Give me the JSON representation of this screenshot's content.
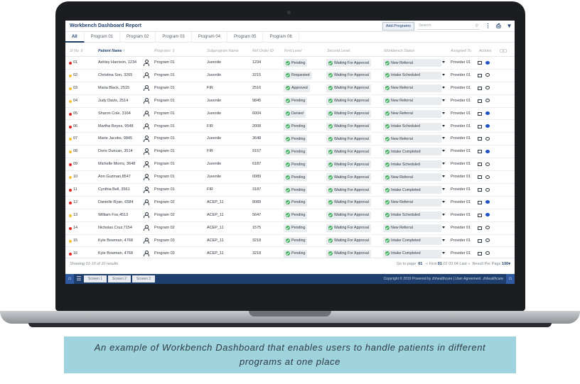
{
  "header": {
    "title": "Workbench Dashboard Report",
    "add_button": "Add Programs",
    "search_placeholder": "Search"
  },
  "tabs": [
    "All",
    "Program 01",
    "Program 02",
    "Program 03",
    "Program 04",
    "Program 05",
    "Program 06"
  ],
  "columns": {
    "sl_no": "Sl No",
    "patient_name": "Patient Name",
    "programs": "Programs",
    "subprogram": "Subprogram Name",
    "ref_order": "Ref Order ID",
    "first_level": "First Level",
    "second_level": "Second Level",
    "workbench_status": "Workbench Status",
    "assigned_to": "Assigned To",
    "actions": "Actions"
  },
  "rows": [
    {
      "sl": "01",
      "priority": "high",
      "name": "Ashley Harrison, 1234",
      "program": "Program 01",
      "sub": "Juvenile",
      "ref": "1234",
      "first": "Pending",
      "second": "Waiting For Approval",
      "status": "New Referral",
      "assigned": "Provider 01",
      "chat": "filled"
    },
    {
      "sl": "02",
      "priority": "medium",
      "name": "Christina Son, 3265",
      "program": "Program 01",
      "sub": "Juvenile",
      "ref": "3215",
      "first": "Requested",
      "second": "Waiting For Approval",
      "status": "Intake Scheduled",
      "assigned": "Provider 01",
      "chat": "outline"
    },
    {
      "sl": "03",
      "priority": "medium",
      "name": "Maria Black, 2515",
      "program": "Program 01",
      "sub": "FIR",
      "ref": "2516",
      "first": "Approved",
      "second": "Waiting For Approval",
      "status": "New Referral",
      "assigned": "Provider 01",
      "chat": "outline"
    },
    {
      "sl": "04",
      "priority": "medium",
      "name": "Judy Davis, 2514",
      "program": "Program 01",
      "sub": "Juvenile",
      "ref": "9845",
      "first": "Pending",
      "second": "Waiting For Approval",
      "status": "New Referral",
      "assigned": "Provider 01",
      "chat": "outline"
    },
    {
      "sl": "05",
      "priority": "high",
      "name": "Sharon Cole, 3164",
      "program": "Program 01",
      "sub": "Juvenile",
      "ref": "6004",
      "first": "Denied",
      "second": "Waiting For Approval",
      "status": "New Referral",
      "assigned": "Provider 01",
      "chat": "filled"
    },
    {
      "sl": "06",
      "priority": "high",
      "name": "Martha Reyes, 9548",
      "program": "Program 01",
      "sub": "FIR",
      "ref": "2008",
      "first": "Pending",
      "second": "Waiting For Approval",
      "status": "Intake Scheduled",
      "assigned": "Provider 01",
      "chat": "filled"
    },
    {
      "sl": "07",
      "priority": "medium",
      "name": "Marie Jacobs, 9845",
      "program": "Program 01",
      "sub": "Juvenile",
      "ref": "3648",
      "first": "Pending",
      "second": "Waiting For Approval",
      "status": "New Referral",
      "assigned": "Provider 01",
      "chat": "outline"
    },
    {
      "sl": "08",
      "priority": "medium",
      "name": "Doris Duncan, 3514",
      "program": "Program 01",
      "sub": "FIR",
      "ref": "9157",
      "first": "Pending",
      "second": "Waiting For Approval",
      "status": "Intake Completed",
      "assigned": "Provider 01",
      "chat": "filled"
    },
    {
      "sl": "09",
      "priority": "high",
      "name": "Michelle Morris, 3648",
      "program": "Program 01",
      "sub": "Juvenile",
      "ref": "6187",
      "first": "Pending",
      "second": "Waiting For Approval",
      "status": "Intake Scheduled",
      "assigned": "Provider 01",
      "chat": "outline"
    },
    {
      "sl": "10",
      "priority": "medium",
      "name": "Ann Guzman,8547",
      "program": "Program 01",
      "sub": "Juvenile",
      "ref": "0089",
      "first": "Pending",
      "second": "Waiting For Approval",
      "status": "New Referral",
      "assigned": "Provider 01",
      "chat": "outline"
    },
    {
      "sl": "11",
      "priority": "high",
      "name": "Cynthia Bell, 3561",
      "program": "Program 01",
      "sub": "FIR",
      "ref": "3187",
      "first": "Pending",
      "second": "Waiting For Approval",
      "status": "Intake Completed",
      "assigned": "Provider 01",
      "chat": "outline"
    },
    {
      "sl": "12",
      "priority": "high",
      "name": "Danielle Ryan, 6584",
      "program": "Program 02",
      "sub": "ACEP_11",
      "ref": "8089",
      "first": "Pending",
      "second": "Waiting For Approval",
      "status": "New Referral",
      "assigned": "Provider 01",
      "chat": "filled"
    },
    {
      "sl": "13",
      "priority": "medium",
      "name": "William Fox,4513",
      "program": "Program 02",
      "sub": "ACEP_11",
      "ref": "5647",
      "first": "Pending",
      "second": "Waiting For Approval",
      "status": "Intake Scheduled",
      "assigned": "Provider 01",
      "chat": "filled"
    },
    {
      "sl": "14",
      "priority": "high",
      "name": "Nicholas Cruz,7154",
      "program": "Program 02",
      "sub": "ACEP_11",
      "ref": "1575",
      "first": "Pending",
      "second": "Waiting For Approval",
      "status": "New Referral",
      "assigned": "Provider 01",
      "chat": "outline"
    },
    {
      "sl": "15",
      "priority": "medium",
      "name": "Kyle Bowman, 4768",
      "program": "Program 03",
      "sub": "ACEP_11",
      "ref": "3218",
      "first": "Pending",
      "second": "Waiting For Approval",
      "status": "Intake Completed",
      "assigned": "Provider 01",
      "chat": "outline"
    },
    {
      "sl": "16",
      "priority": "high",
      "name": "Kyle Bowman, 4768",
      "program": "Program 03",
      "sub": "ACEP_11",
      "ref": "3218",
      "first": "Pending",
      "second": "Waiting For Approval",
      "status": "Intake Completed",
      "assigned": "Provider 01",
      "chat": "outline"
    }
  ],
  "footer": {
    "showing": "Showing 01-10 of 10 results",
    "goto_label": "Go to page",
    "goto_value": "01",
    "first": "First",
    "pages": [
      "01",
      "02",
      "03",
      "04"
    ],
    "last": "Last",
    "per_page_label": "Result Per Page",
    "per_page_value": "100"
  },
  "statusbar": {
    "screens": [
      "Screen 1",
      "Screen 2",
      "Screen 3"
    ],
    "copyright": "Copyright © 2019 Powered by zhhealthcare | User Agreement",
    "brand": "zhhealthcare"
  },
  "colors": {
    "brand": "#1e3f6e",
    "priority_high": "#e02424",
    "priority_medium": "#f2c230",
    "check": "#3fae5c",
    "chat_filled": "#1e4fc4"
  },
  "caption": "An example of Workbench Dashboard that enables users to handle patients in different programs at one place"
}
